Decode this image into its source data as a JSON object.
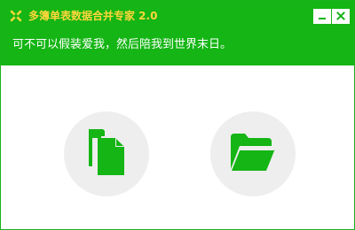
{
  "window": {
    "title": "多簿单表数据合并专家 2.0",
    "subtitle": "可不可以假装爱我，然后陪我到世界末日。"
  },
  "controls": {
    "minimize": "minimize-icon",
    "close": "close-icon"
  },
  "actions": [
    {
      "icon": "copy-files-icon"
    },
    {
      "icon": "folder-open-icon"
    }
  ],
  "colors": {
    "accent": "#14b514",
    "title_text": "#ffd63a",
    "circle_bg": "#eeeeee"
  }
}
